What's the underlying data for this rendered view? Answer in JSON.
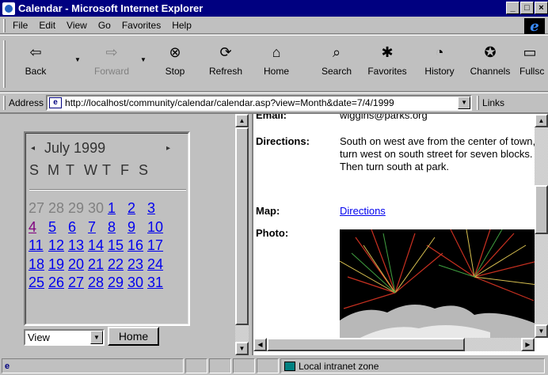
{
  "window": {
    "title": "Calendar - Microsoft Internet Explorer",
    "minimize": "_",
    "maximize": "□",
    "close": "×"
  },
  "menu": {
    "items": [
      "File",
      "Edit",
      "View",
      "Go",
      "Favorites",
      "Help"
    ]
  },
  "toolbar": {
    "buttons": [
      {
        "label": "Back",
        "icon": "back-arrow-icon"
      },
      {
        "label": "Forward",
        "icon": "forward-arrow-icon",
        "disabled": true
      },
      {
        "label": "Stop",
        "icon": "stop-icon"
      },
      {
        "label": "Refresh",
        "icon": "refresh-icon"
      },
      {
        "label": "Home",
        "icon": "home-icon"
      },
      {
        "label": "Search",
        "icon": "search-icon"
      },
      {
        "label": "Favorites",
        "icon": "favorites-icon"
      },
      {
        "label": "History",
        "icon": "history-icon"
      },
      {
        "label": "Channels",
        "icon": "channels-icon"
      },
      {
        "label": "Fullsc",
        "icon": "fullscreen-icon"
      }
    ]
  },
  "address": {
    "label": "Address",
    "url": "http://localhost/community/calendar/calendar.asp?view=Month&date=7/4/1999",
    "links_label": "Links"
  },
  "calendar": {
    "month_title": "July 1999",
    "prev_symbol": "◂",
    "next_symbol": "▸",
    "weekdays": [
      "S",
      "M",
      "T",
      "W",
      "T",
      "F",
      "S"
    ],
    "weeks": [
      [
        {
          "d": "27",
          "t": "other"
        },
        {
          "d": "28",
          "t": "other"
        },
        {
          "d": "29",
          "t": "other"
        },
        {
          "d": "30",
          "t": "other"
        },
        {
          "d": "1",
          "t": "link"
        },
        {
          "d": "2",
          "t": "link"
        },
        {
          "d": "3",
          "t": "link"
        }
      ],
      [
        {
          "d": "4",
          "t": "visited"
        },
        {
          "d": "5",
          "t": "link"
        },
        {
          "d": "6",
          "t": "link"
        },
        {
          "d": "7",
          "t": "link"
        },
        {
          "d": "8",
          "t": "link"
        },
        {
          "d": "9",
          "t": "link"
        },
        {
          "d": "10",
          "t": "link"
        }
      ],
      [
        {
          "d": "11",
          "t": "link"
        },
        {
          "d": "12",
          "t": "link"
        },
        {
          "d": "13",
          "t": "link"
        },
        {
          "d": "14",
          "t": "link"
        },
        {
          "d": "15",
          "t": "link"
        },
        {
          "d": "16",
          "t": "link"
        },
        {
          "d": "17",
          "t": "link"
        }
      ],
      [
        {
          "d": "18",
          "t": "link"
        },
        {
          "d": "19",
          "t": "link"
        },
        {
          "d": "20",
          "t": "link"
        },
        {
          "d": "21",
          "t": "link"
        },
        {
          "d": "22",
          "t": "link"
        },
        {
          "d": "23",
          "t": "link"
        },
        {
          "d": "24",
          "t": "link"
        }
      ],
      [
        {
          "d": "25",
          "t": "link"
        },
        {
          "d": "26",
          "t": "link"
        },
        {
          "d": "27",
          "t": "link"
        },
        {
          "d": "28",
          "t": "link"
        },
        {
          "d": "29",
          "t": "link"
        },
        {
          "d": "30",
          "t": "link"
        },
        {
          "d": "31",
          "t": "link"
        }
      ]
    ],
    "view_select": "View",
    "home_button": "Home"
  },
  "event": {
    "email_label": "Email:",
    "email_value": "wiggins@parks.org",
    "directions_label": "Directions:",
    "directions_value": "South on west ave from the center of town, turn west on south street for seven blocks. Then turn south at park.",
    "map_label": "Map:",
    "map_link": "Directions",
    "photo_label": "Photo:"
  },
  "status": {
    "zone": "Local intranet zone"
  },
  "colors": {
    "title_bar": "#000080",
    "link": "#0000ee",
    "visited_link": "#800080",
    "chrome": "#c0c0c0"
  }
}
